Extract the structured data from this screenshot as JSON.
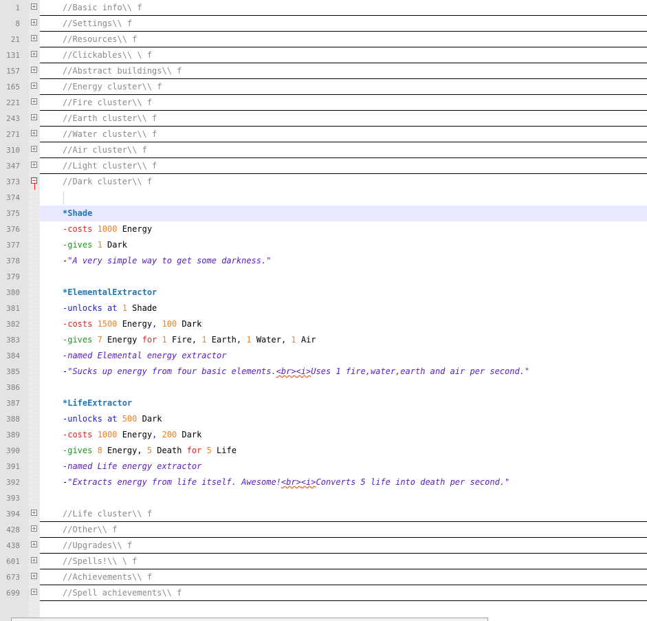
{
  "editor": {
    "lines": [
      {
        "num": "1",
        "fold": "plus",
        "folded": true,
        "tokens": [
          [
            "comment",
            "//Basic info\\\\ f"
          ]
        ]
      },
      {
        "num": "8",
        "fold": "plus",
        "folded": true,
        "tokens": [
          [
            "comment",
            "//Settings\\\\ f"
          ]
        ]
      },
      {
        "num": "21",
        "fold": "plus",
        "folded": true,
        "tokens": [
          [
            "comment",
            "//Resources\\\\ f"
          ]
        ]
      },
      {
        "num": "131",
        "fold": "plus",
        "folded": true,
        "tokens": [
          [
            "comment",
            "//Clickables\\\\ \\ f"
          ]
        ]
      },
      {
        "num": "157",
        "fold": "plus",
        "folded": true,
        "tokens": [
          [
            "comment",
            "//Abstract buildings\\\\ f"
          ]
        ]
      },
      {
        "num": "165",
        "fold": "plus",
        "folded": true,
        "tokens": [
          [
            "comment",
            "//Energy cluster\\\\ f"
          ]
        ]
      },
      {
        "num": "221",
        "fold": "plus",
        "folded": true,
        "tokens": [
          [
            "comment",
            "//Fire cluster\\\\ f"
          ]
        ]
      },
      {
        "num": "243",
        "fold": "plus",
        "folded": true,
        "tokens": [
          [
            "comment",
            "//Earth cluster\\\\ f"
          ]
        ]
      },
      {
        "num": "271",
        "fold": "plus",
        "folded": true,
        "tokens": [
          [
            "comment",
            "//Water cluster\\\\ f"
          ]
        ]
      },
      {
        "num": "310",
        "fold": "plus",
        "folded": true,
        "tokens": [
          [
            "comment",
            "//Air cluster\\\\ f"
          ]
        ]
      },
      {
        "num": "347",
        "fold": "plus",
        "folded": true,
        "tokens": [
          [
            "comment",
            "//Light cluster\\\\ f"
          ]
        ]
      },
      {
        "num": "373",
        "fold": "open",
        "folded": false,
        "tokens": [
          [
            "comment",
            "//Dark cluster\\\\ f"
          ]
        ]
      },
      {
        "num": "374",
        "fold": "",
        "folded": false,
        "tokens": []
      },
      {
        "num": "375",
        "fold": "",
        "folded": false,
        "highlight": true,
        "tokens": [
          [
            "star",
            "*Shade"
          ]
        ]
      },
      {
        "num": "376",
        "fold": "",
        "folded": false,
        "tokens": [
          [
            "costs",
            "-costs "
          ],
          [
            "num",
            "1000"
          ],
          [
            "plain",
            " Energy"
          ]
        ]
      },
      {
        "num": "377",
        "fold": "",
        "folded": false,
        "tokens": [
          [
            "gives",
            "-gives "
          ],
          [
            "num",
            "1"
          ],
          [
            "plain",
            " Dark"
          ]
        ]
      },
      {
        "num": "378",
        "fold": "",
        "folded": false,
        "tokens": [
          [
            "plain",
            "-"
          ],
          [
            "quote",
            "\"A very simple way to get some darkness.\""
          ]
        ]
      },
      {
        "num": "379",
        "fold": "",
        "folded": false,
        "tokens": []
      },
      {
        "num": "380",
        "fold": "",
        "folded": false,
        "tokens": [
          [
            "star",
            "*ElementalExtractor"
          ]
        ]
      },
      {
        "num": "381",
        "fold": "",
        "folded": false,
        "tokens": [
          [
            "unlock",
            "-unlocks at "
          ],
          [
            "num",
            "1"
          ],
          [
            "plain",
            " Shade"
          ]
        ]
      },
      {
        "num": "382",
        "fold": "",
        "folded": false,
        "tokens": [
          [
            "costs",
            "-costs "
          ],
          [
            "num",
            "1500"
          ],
          [
            "plain",
            " Energy"
          ],
          [
            "unlock",
            ", "
          ],
          [
            "num",
            "100"
          ],
          [
            "plain",
            " Dark"
          ]
        ]
      },
      {
        "num": "383",
        "fold": "",
        "folded": false,
        "tokens": [
          [
            "gives",
            "-gives "
          ],
          [
            "num",
            "7"
          ],
          [
            "plain",
            " Energy "
          ],
          [
            "for",
            "for "
          ],
          [
            "num",
            "1"
          ],
          [
            "plain",
            " Fire, "
          ],
          [
            "num",
            "1"
          ],
          [
            "plain",
            " Earth, "
          ],
          [
            "num",
            "1"
          ],
          [
            "plain",
            " Water, "
          ],
          [
            "num",
            "1"
          ],
          [
            "plain",
            " Air"
          ]
        ]
      },
      {
        "num": "384",
        "fold": "",
        "folded": false,
        "tokens": [
          [
            "named",
            "-named Elemental energy extractor"
          ]
        ]
      },
      {
        "num": "385",
        "fold": "",
        "folded": false,
        "tokens": [
          [
            "plain",
            "-"
          ],
          [
            "quote",
            "\"Sucks up energy from four basic elements."
          ],
          [
            "html",
            "<br>"
          ],
          [
            "html",
            "<i>"
          ],
          [
            "quote",
            "Uses 1 fire,water,earth and air per second.\""
          ]
        ]
      },
      {
        "num": "386",
        "fold": "",
        "folded": false,
        "tokens": []
      },
      {
        "num": "387",
        "fold": "",
        "folded": false,
        "tokens": [
          [
            "star",
            "*LifeExtractor"
          ]
        ]
      },
      {
        "num": "388",
        "fold": "",
        "folded": false,
        "tokens": [
          [
            "unlock",
            "-unlocks at "
          ],
          [
            "num",
            "500"
          ],
          [
            "plain",
            " Dark"
          ]
        ]
      },
      {
        "num": "389",
        "fold": "",
        "folded": false,
        "tokens": [
          [
            "costs",
            "-costs "
          ],
          [
            "num",
            "1000"
          ],
          [
            "plain",
            " Energy"
          ],
          [
            "unlock",
            ", "
          ],
          [
            "num",
            "200"
          ],
          [
            "plain",
            " Dark"
          ]
        ]
      },
      {
        "num": "390",
        "fold": "",
        "folded": false,
        "tokens": [
          [
            "gives",
            "-gives "
          ],
          [
            "num",
            "8"
          ],
          [
            "plain",
            " Energy, "
          ],
          [
            "num",
            "5"
          ],
          [
            "plain",
            " Death "
          ],
          [
            "for",
            "for "
          ],
          [
            "num",
            "5"
          ],
          [
            "plain",
            " Life"
          ]
        ]
      },
      {
        "num": "391",
        "fold": "",
        "folded": false,
        "tokens": [
          [
            "named",
            "-named Life energy extractor"
          ]
        ]
      },
      {
        "num": "392",
        "fold": "",
        "folded": false,
        "tokens": [
          [
            "plain",
            "-"
          ],
          [
            "quote",
            "\"Extracts energy from life itself. Awesome!"
          ],
          [
            "html",
            "<br>"
          ],
          [
            "html",
            "<i>"
          ],
          [
            "quote",
            "Converts 5 life into death per second.\""
          ]
        ]
      },
      {
        "num": "393",
        "fold": "",
        "folded": false,
        "tokens": []
      },
      {
        "num": "394",
        "fold": "plus",
        "folded": true,
        "tokens": [
          [
            "comment",
            "//Life cluster\\\\ f"
          ]
        ]
      },
      {
        "num": "428",
        "fold": "plus",
        "folded": true,
        "tokens": [
          [
            "comment",
            "//Other\\\\ f"
          ]
        ]
      },
      {
        "num": "438",
        "fold": "plus",
        "folded": true,
        "tokens": [
          [
            "comment",
            "//Upgrades\\\\ f"
          ]
        ]
      },
      {
        "num": "601",
        "fold": "plus",
        "folded": true,
        "tokens": [
          [
            "comment",
            "//Spells!\\\\ \\ f"
          ]
        ]
      },
      {
        "num": "673",
        "fold": "plus",
        "folded": true,
        "tokens": [
          [
            "comment",
            "//Achievements\\\\ f"
          ]
        ]
      },
      {
        "num": "699",
        "fold": "plus",
        "folded": true,
        "tokens": [
          [
            "comment",
            "//Spell achievements\\\\ f"
          ]
        ]
      }
    ]
  }
}
